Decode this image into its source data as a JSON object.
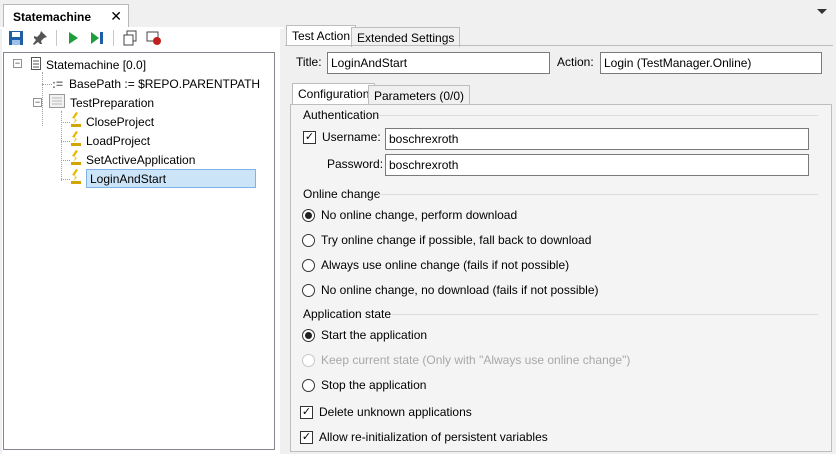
{
  "document_tab": {
    "title": "Statemachine",
    "close": "✕"
  },
  "tree": {
    "root": "Statemachine [0.0]",
    "basepath": "BasePath := $REPO.PARENTPATH",
    "group": "TestPreparation",
    "items": [
      "CloseProject",
      "LoadProject",
      "SetActiveApplication",
      "LoginAndStart"
    ],
    "selected": "LoginAndStart"
  },
  "top_tabs": [
    "Test Action",
    "Extended Settings"
  ],
  "title_label": "Title:",
  "title_value": "LoginAndStart",
  "action_label": "Action:",
  "action_value": "Login (TestManager.Online)",
  "inner_tabs": [
    "Configuration",
    "Parameters (0/0)"
  ],
  "authentication": {
    "title": "Authentication",
    "username_label": "Username:",
    "username_value": "boschrexroth",
    "username_checked": true,
    "password_label": "Password:",
    "password_value": "boschrexroth"
  },
  "online_change": {
    "title": "Online change",
    "options": [
      "No online change, perform download",
      "Try online change if possible, fall back to download",
      "Always use online change (fails if not possible)",
      "No online change, no download (fails if not possible)"
    ],
    "selected": 0
  },
  "application_state": {
    "title": "Application state",
    "options": [
      "Start the application",
      "Keep current state (Only with \"Always use online change\")",
      "Stop the application"
    ],
    "selected": 0,
    "disabled": 1
  },
  "checkboxes": [
    {
      "label": "Delete unknown applications",
      "checked": true
    },
    {
      "label": "Allow re-initialization of persistent variables",
      "checked": true
    }
  ],
  "colors": {
    "selection_bg": "#cce4f7",
    "selection_border": "#7eb4ea",
    "play_green": "#1e9e3a",
    "save_blue": "#1f5fa8"
  },
  "icons": [
    "save-icon",
    "pin-icon",
    "run-icon",
    "step-icon",
    "copy-icon",
    "record-icon",
    "dropdown-arrow-icon"
  ]
}
